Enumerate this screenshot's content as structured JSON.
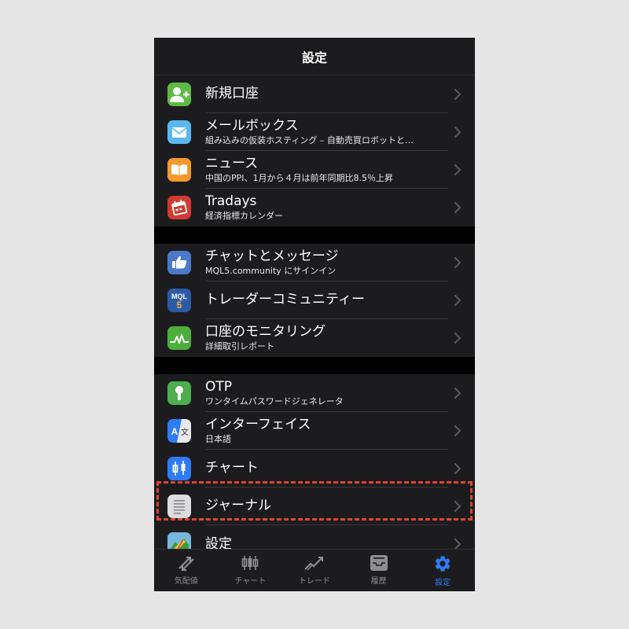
{
  "header": {
    "title": "設定"
  },
  "groups": [
    {
      "items": [
        {
          "title": "新規口座",
          "subtitle": "",
          "icon": "add-account-icon"
        },
        {
          "title": "メールボックス",
          "subtitle": "組み込みの仮装ホスティング – 自動売買ロボットと…",
          "icon": "mail-icon"
        },
        {
          "title": "ニュース",
          "subtitle": "中国のPPI、1月から４月は前年同期比8.5％上昇",
          "icon": "news-book-icon"
        },
        {
          "title": "Tradays",
          "subtitle": "経済指標カレンダー",
          "icon": "calendar-icon"
        }
      ]
    },
    {
      "items": [
        {
          "title": "チャットとメッセージ",
          "subtitle": "MQL5.community にサインイン",
          "icon": "chat-hand-icon"
        },
        {
          "title": "トレーダーコミュニティー",
          "subtitle": "",
          "icon": "mql5-icon"
        },
        {
          "title": "口座のモニタリング",
          "subtitle": "詳細取引レポート",
          "icon": "monitoring-icon"
        }
      ]
    },
    {
      "items": [
        {
          "title": "OTP",
          "subtitle": "ワンタイムパスワードジェネレータ",
          "icon": "otp-key-icon"
        },
        {
          "title": "インターフェイス",
          "subtitle": "日本語",
          "icon": "language-icon"
        },
        {
          "title": "チャート",
          "subtitle": "",
          "icon": "candlestick-icon"
        },
        {
          "title": "ジャーナル",
          "subtitle": "",
          "icon": "journal-icon"
        },
        {
          "title": "設定",
          "subtitle": "",
          "icon": "settings-app-icon"
        }
      ]
    }
  ],
  "tabs": [
    {
      "label": "気配値",
      "icon": "quotes-icon",
      "active": false
    },
    {
      "label": "チャート",
      "icon": "chart-icon",
      "active": false
    },
    {
      "label": "トレード",
      "icon": "trade-icon",
      "active": false
    },
    {
      "label": "履歴",
      "icon": "history-icon",
      "active": false
    },
    {
      "label": "設定",
      "icon": "gear-icon",
      "active": true
    }
  ],
  "colors": {
    "accent": "#2f7bf5",
    "highlight": "#e0442a",
    "background": "#000000",
    "row": "#1c1c1e"
  }
}
